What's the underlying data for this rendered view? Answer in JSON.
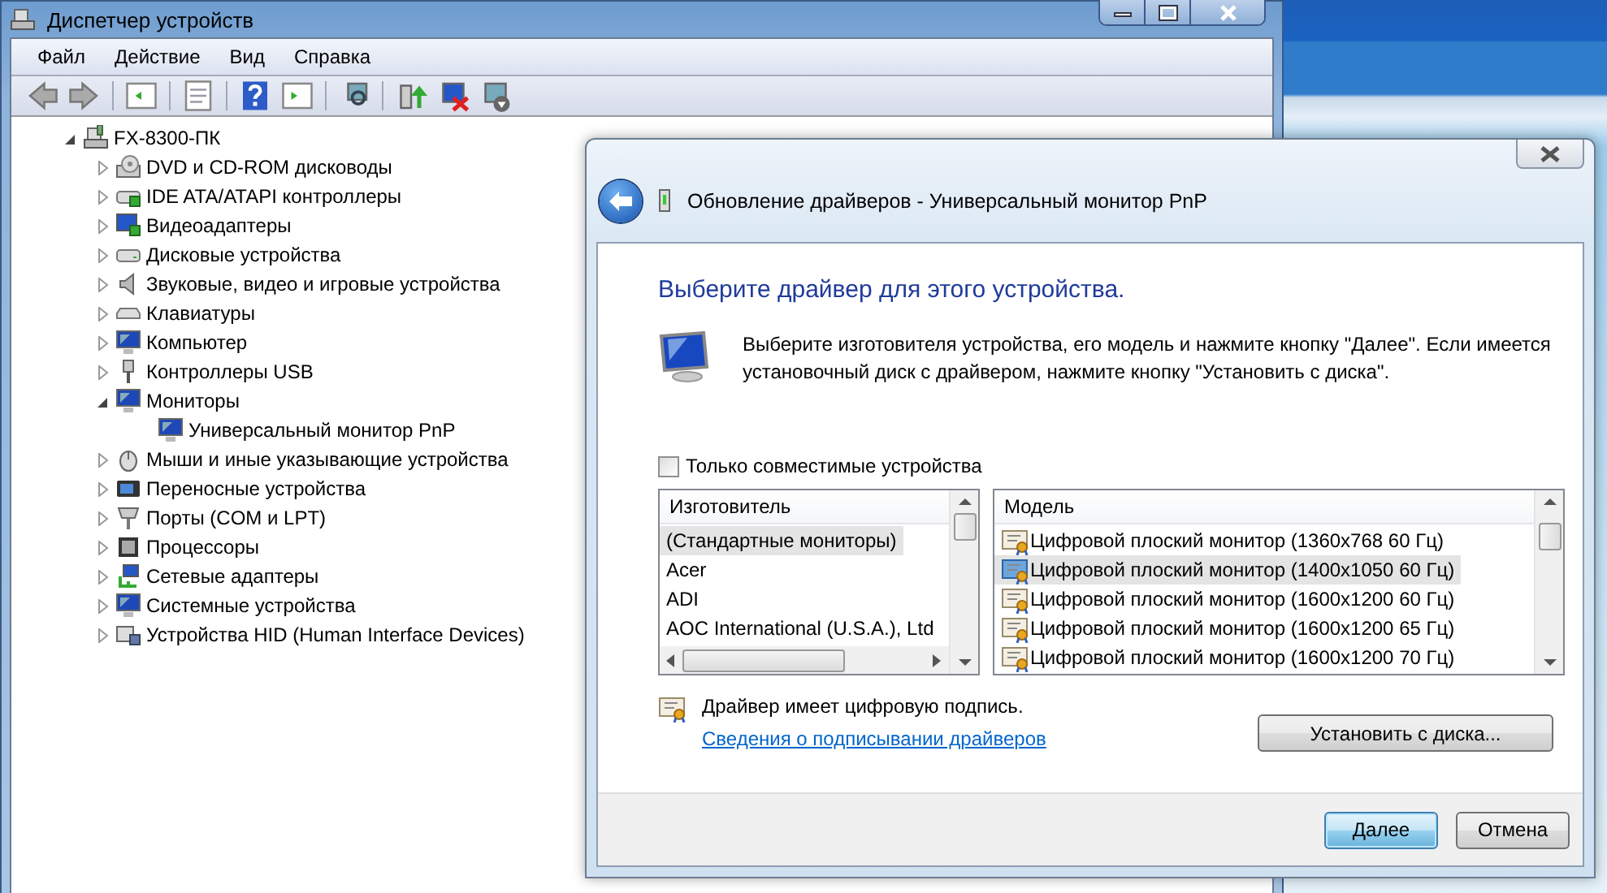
{
  "device_manager": {
    "title": "Диспетчер устройств",
    "menu": [
      "Файл",
      "Действие",
      "Вид",
      "Справка"
    ],
    "tree": {
      "label": "FX-8300-ПК",
      "expanded": true,
      "kind": "computer",
      "children": [
        {
          "label": "DVD и CD-ROM дисководы",
          "kind": "disc",
          "expanded": false
        },
        {
          "label": "IDE ATA/ATAPI контроллеры",
          "kind": "controller",
          "expanded": false
        },
        {
          "label": "Видеоадаптеры",
          "kind": "display",
          "expanded": false
        },
        {
          "label": "Дисковые устройства",
          "kind": "drive",
          "expanded": false
        },
        {
          "label": "Звуковые, видео и игровые устройства",
          "kind": "speaker",
          "expanded": false
        },
        {
          "label": "Клавиатуры",
          "kind": "keyboard",
          "expanded": false
        },
        {
          "label": "Компьютер",
          "kind": "monitor",
          "expanded": false
        },
        {
          "label": "Контроллеры USB",
          "kind": "usb",
          "expanded": false
        },
        {
          "label": "Мониторы",
          "kind": "monitor",
          "expanded": true,
          "children": [
            {
              "label": "Универсальный монитор PnP",
              "kind": "monitor"
            }
          ]
        },
        {
          "label": "Мыши и иные указывающие устройства",
          "kind": "mouse",
          "expanded": false
        },
        {
          "label": "Переносные устройства",
          "kind": "portable",
          "expanded": false
        },
        {
          "label": "Порты (COM и LPT)",
          "kind": "port",
          "expanded": false
        },
        {
          "label": "Процессоры",
          "kind": "cpu",
          "expanded": false
        },
        {
          "label": "Сетевые адаптеры",
          "kind": "network",
          "expanded": false
        },
        {
          "label": "Системные устройства",
          "kind": "monitor",
          "expanded": false
        },
        {
          "label": "Устройства HID (Human Interface Devices)",
          "kind": "hid",
          "expanded": false
        }
      ]
    }
  },
  "dialog": {
    "title": "Обновление драйверов - Универсальный монитор PnP",
    "heading": "Выберите драйвер для этого устройства.",
    "description": "Выберите изготовителя устройства, его модель и нажмите кнопку \"Далее\". Если имеется установочный диск с  драйвером, нажмите кнопку \"Установить с диска\".",
    "compatible_only": {
      "label": "Только совместимые устройства",
      "checked": false
    },
    "manufacturers": {
      "header": "Изготовитель",
      "items": [
        {
          "label": "(Стандартные мониторы)",
          "selected": true
        },
        {
          "label": "Acer",
          "selected": false
        },
        {
          "label": "ADI",
          "selected": false
        },
        {
          "label": "AOC International (U.S.A.), Ltd",
          "selected": false
        }
      ]
    },
    "models": {
      "header": "Модель",
      "items": [
        {
          "label": "Цифровой плоский монитор (1360x768 60 Гц)",
          "selected": false
        },
        {
          "label": "Цифровой плоский монитор (1400x1050 60 Гц)",
          "selected": true
        },
        {
          "label": "Цифровой плоский монитор (1600x1200 60 Гц)",
          "selected": false
        },
        {
          "label": "Цифровой плоский монитор (1600x1200 65 Гц)",
          "selected": false
        },
        {
          "label": "Цифровой плоский монитор (1600x1200 70 Гц)",
          "selected": false
        }
      ]
    },
    "signature_note": "Драйвер имеет цифровую подпись.",
    "signature_link": "Сведения о подписывании драйверов",
    "buttons": [
      {
        "label": "Установить с диска...",
        "kind": "install"
      },
      {
        "label": "Далее",
        "kind": "next"
      },
      {
        "label": "Отмена",
        "kind": "cancel"
      }
    ]
  }
}
